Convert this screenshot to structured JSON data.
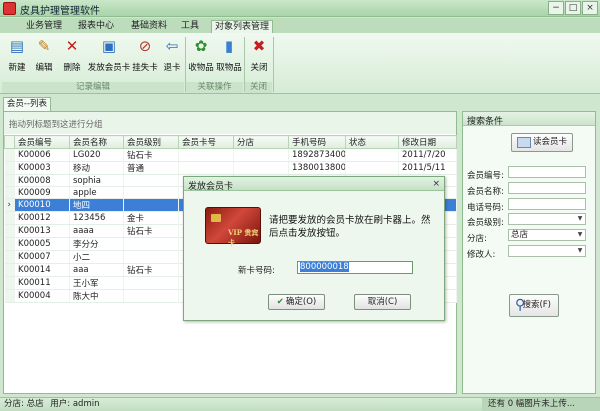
{
  "app": {
    "title": "皮具护理管理软件"
  },
  "window_controls": [
    "−",
    "□",
    "×"
  ],
  "ribbon_tabs": [
    "业务管理",
    "报表中心",
    "基础资料",
    "工具",
    "对象列表管理"
  ],
  "ribbon": {
    "tools": [
      {
        "label": "新建",
        "icon": "new-doc-icon",
        "glyph": "▤",
        "color": "#2e6fbf"
      },
      {
        "label": "编辑",
        "icon": "edit-pencil-icon",
        "glyph": "✎",
        "color": "#c07a18"
      },
      {
        "label": "删除",
        "icon": "delete-x-icon",
        "glyph": "✕",
        "color": "#c41e1e"
      },
      {
        "label": "发放会员卡",
        "icon": "issue-card-icon",
        "glyph": "▣",
        "color": "#2e6fbf"
      },
      {
        "label": "挂失卡",
        "icon": "lost-card-icon",
        "glyph": "⊘",
        "color": "#b23b2a"
      },
      {
        "label": "退卡",
        "icon": "return-card-icon",
        "glyph": "⇦",
        "color": "#2e6fbf"
      },
      {
        "label": "收物品",
        "icon": "receive-goods-icon",
        "glyph": "✿",
        "color": "#2f8f2f"
      },
      {
        "label": "取物品",
        "icon": "take-goods-icon",
        "glyph": "▮",
        "color": "#3a7fd0"
      },
      {
        "label": "关闭",
        "icon": "close-red-icon",
        "glyph": "✖",
        "color": "#c41e1e"
      }
    ],
    "groups": [
      "记录编辑",
      "关联操作",
      "关闭"
    ]
  },
  "doc_tab": "会员--列表",
  "grid": {
    "group_hint": "拖动列标题到这进行分组",
    "columns": [
      "会员编号",
      "会员名称",
      "会员级别",
      "会员卡号",
      "分店",
      "手机号码",
      "状态",
      "修改日期"
    ],
    "rows": [
      [
        "K00006",
        "LG020",
        "钻石卡",
        "",
        "",
        "18928734000",
        "",
        "2011/7/20"
      ],
      [
        "K00003",
        "移动",
        "普通",
        "",
        "",
        "13800138000",
        "",
        "2011/5/11"
      ],
      [
        "K00008",
        "sophia",
        "",
        "",
        "",
        "",
        "",
        ""
      ],
      [
        "K00009",
        "apple",
        "",
        "",
        "",
        "",
        "",
        ""
      ],
      [
        "K00010",
        "地四",
        "",
        "",
        "",
        "",
        "",
        ""
      ],
      [
        "K00012",
        "123456",
        "金卡",
        "",
        "",
        "",
        "",
        ""
      ],
      [
        "K00013",
        "aaaa",
        "钻石卡",
        "",
        "",
        "",
        "",
        ""
      ],
      [
        "K00005",
        "李分分",
        "",
        "",
        "",
        "",
        "",
        ""
      ],
      [
        "K00007",
        "小二",
        "",
        "",
        "",
        "",
        "",
        ""
      ],
      [
        "K00014",
        "aaa",
        "钻石卡",
        "",
        "",
        "",
        "",
        ""
      ],
      [
        "K00011",
        "王小军",
        "",
        "",
        "",
        "",
        "",
        ""
      ],
      [
        "K00004",
        "陈大中",
        "",
        "",
        "",
        "",
        "",
        ""
      ]
    ],
    "selected_row": 4
  },
  "search": {
    "title": "搜索条件",
    "read_card_button": "读会员卡",
    "fields": [
      {
        "label": "会员编号:",
        "value": "",
        "dropdown": false
      },
      {
        "label": "会员名称:",
        "value": "",
        "dropdown": false
      },
      {
        "label": "电话号码:",
        "value": "",
        "dropdown": false
      },
      {
        "label": "会员级别:",
        "value": "",
        "dropdown": true
      },
      {
        "label": "分店:",
        "value": "总店",
        "dropdown": true
      },
      {
        "label": "修改人:",
        "value": "",
        "dropdown": true
      }
    ],
    "search_button": "搜索(F)"
  },
  "status": {
    "branch": "分店: 总店",
    "user": "用户: admin",
    "right": "还有 0 幅图片未上传..."
  },
  "dialog": {
    "title": "发放会员卡",
    "close": "×",
    "card_text": "VIP 贵宾卡",
    "message": "请把要发放的会员卡放在刷卡器上。然后点击发放按钮。",
    "field_label": "新卡号码:",
    "field_value": "800000018",
    "ok_button": "确定(O)",
    "cancel_button": "取消(C)"
  }
}
